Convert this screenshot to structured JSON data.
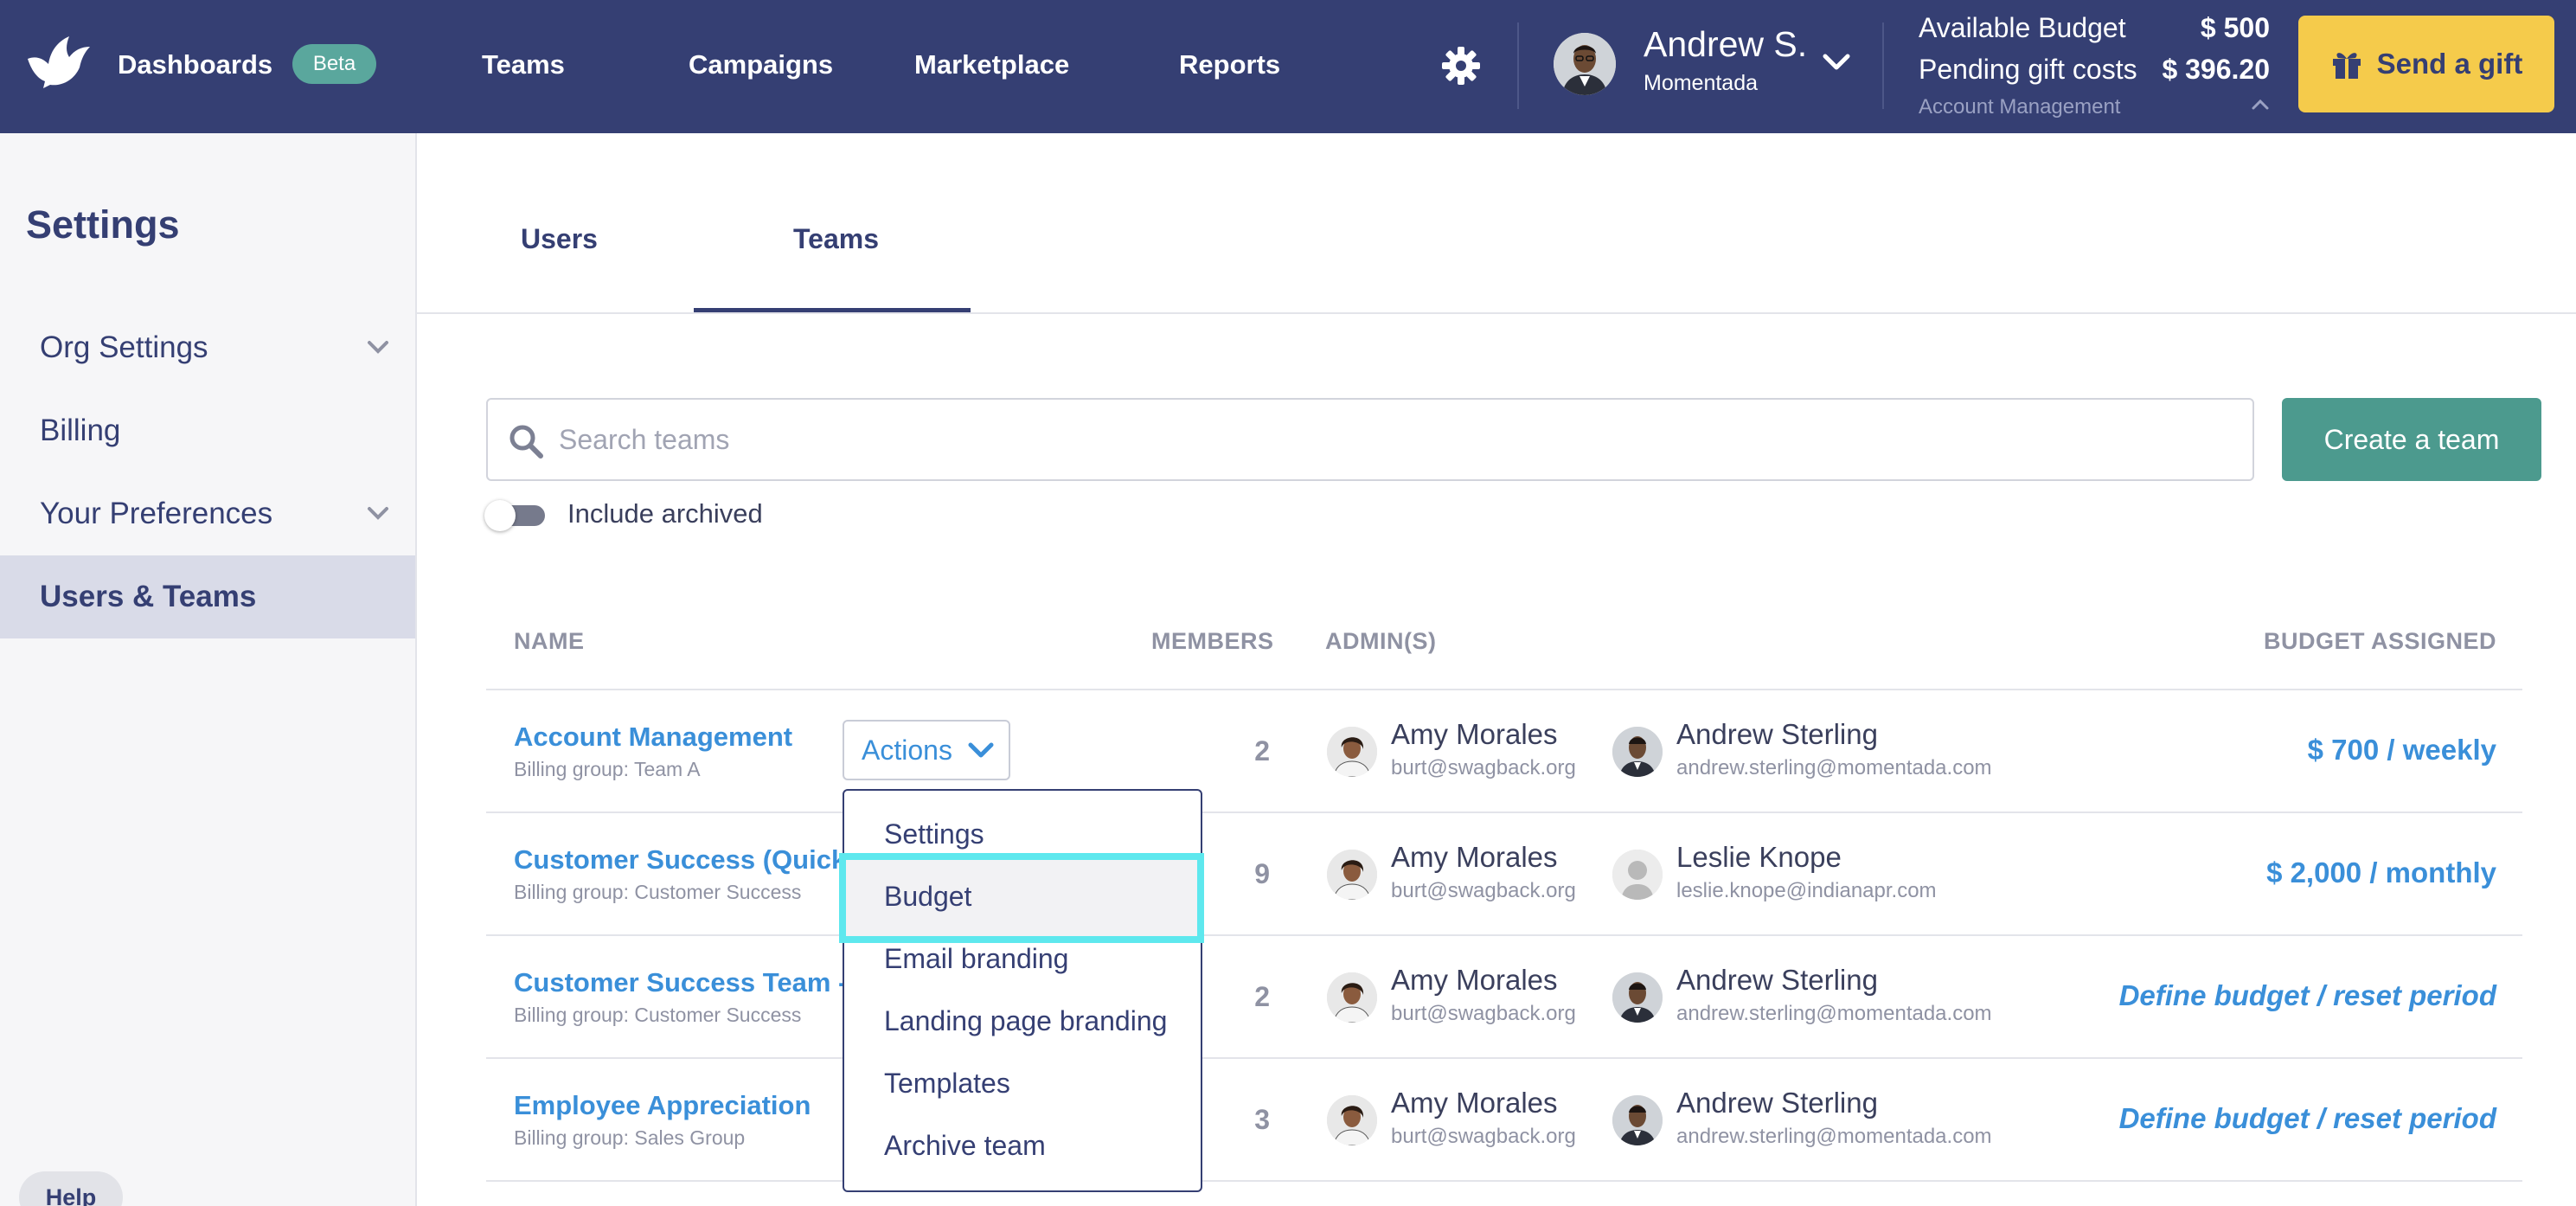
{
  "topbar": {
    "nav": [
      "Dashboards",
      "Teams",
      "Campaigns",
      "Marketplace",
      "Reports"
    ],
    "beta_badge": "Beta",
    "user": {
      "name": "Andrew S.",
      "org": "Momentada"
    },
    "budget": {
      "available_label": "Available Budget",
      "available_value": "$ 500",
      "pending_label": "Pending gift costs",
      "pending_value": "$ 396.20",
      "account_label": "Account Management"
    },
    "send_gift_label": "Send a gift",
    "colors": {
      "bar": "#353f73",
      "gift_button": "#f5cb4b",
      "beta": "#5aa79d"
    }
  },
  "sidebar": {
    "title": "Settings",
    "items": [
      {
        "label": "Org Settings",
        "chevron": true
      },
      {
        "label": "Billing",
        "chevron": false
      },
      {
        "label": "Your Preferences",
        "chevron": true
      },
      {
        "label": "Users & Teams",
        "chevron": false,
        "active": true
      }
    ],
    "help_label": "Help"
  },
  "tabs": [
    {
      "label": "Users",
      "active": false
    },
    {
      "label": "Teams",
      "active": true
    }
  ],
  "search": {
    "placeholder": "Search teams",
    "value": ""
  },
  "create_team_label": "Create a team",
  "include_archived": {
    "label": "Include archived",
    "on": false
  },
  "table": {
    "headers": {
      "name": "NAME",
      "members": "MEMBERS",
      "admins": "ADMIN(S)",
      "budget": "BUDGET ASSIGNED"
    },
    "rows": [
      {
        "name": "Account Management",
        "billing": "Billing group: Team A",
        "members": "2",
        "admin1": {
          "name": "Amy Morales",
          "email": "burt@swagback.org"
        },
        "admin2": {
          "name": "Andrew Sterling",
          "email": "andrew.sterling@momentada.com"
        },
        "budget": "$ 700 / weekly"
      },
      {
        "name": "Customer Success (QuickS",
        "billing": "Billing group: Customer Success",
        "members": "9",
        "admin1": {
          "name": "Amy Morales",
          "email": "burt@swagback.org"
        },
        "admin2": {
          "name": "Leslie Knope",
          "email": "leslie.knope@indianapr.com"
        },
        "budget": "$ 2,000 / monthly"
      },
      {
        "name": "Customer Success Team - E",
        "billing": "Billing group: Customer Success",
        "members": "2",
        "admin1": {
          "name": "Amy Morales",
          "email": "burt@swagback.org"
        },
        "admin2": {
          "name": "Andrew Sterling",
          "email": "andrew.sterling@momentada.com"
        },
        "budget": "Define budget / reset period"
      },
      {
        "name": "Employee Appreciation",
        "billing": "Billing group: Sales Group",
        "members": "3",
        "admin1": {
          "name": "Amy Morales",
          "email": "burt@swagback.org"
        },
        "admin2": {
          "name": "Andrew Sterling",
          "email": "andrew.sterling@momentada.com"
        },
        "budget": "Define budget / reset period"
      }
    ]
  },
  "actions": {
    "label": "Actions",
    "menu": [
      "Settings",
      "Budget",
      "Email branding",
      "Landing page branding",
      "Templates",
      "Archive team"
    ],
    "highlighted": "Budget"
  }
}
